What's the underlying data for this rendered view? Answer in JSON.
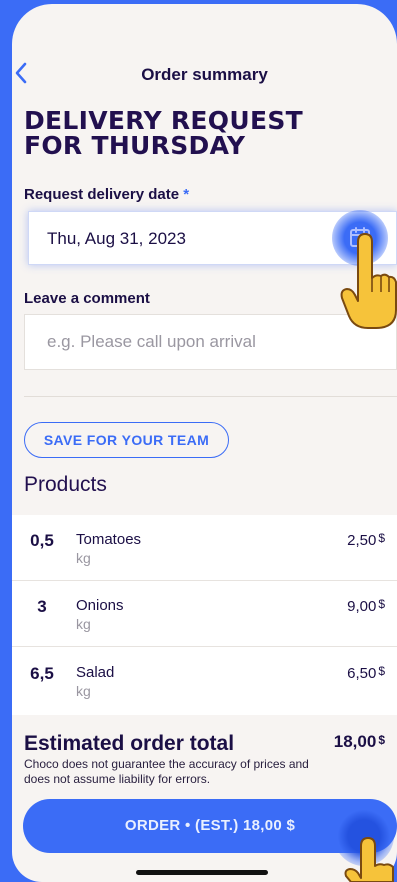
{
  "header": {
    "title": "Order summary"
  },
  "headline": {
    "line1": "DELIVERY REQUEST",
    "line2": "FOR THURSDAY"
  },
  "delivery_date": {
    "label": "Request delivery date",
    "required_mark": "*",
    "value": "Thu, Aug 31, 2023"
  },
  "comment": {
    "label": "Leave a comment",
    "placeholder": "e.g. Please call upon arrival"
  },
  "save_button": {
    "label": "SAVE FOR YOUR TEAM"
  },
  "products": {
    "title": "Products",
    "items": [
      {
        "qty": "0,5",
        "name": "Tomatoes",
        "unit": "kg",
        "price": "2,50",
        "currency": "$"
      },
      {
        "qty": "3",
        "name": "Onions",
        "unit": "kg",
        "price": "9,00",
        "currency": "$"
      },
      {
        "qty": "6,5",
        "name": "Salad",
        "unit": "kg",
        "price": "6,50",
        "currency": "$"
      }
    ]
  },
  "total": {
    "label": "Estimated order total",
    "value": "18,00",
    "currency": "$",
    "disclaimer": "Choco does not guarantee the accuracy of prices and does not assume liability for errors."
  },
  "order_button": {
    "label": "ORDER • (EST.) 18,00 $"
  },
  "colors": {
    "accent": "#3b6cf6",
    "heading": "#22104f",
    "background": "#f7f4f2"
  }
}
